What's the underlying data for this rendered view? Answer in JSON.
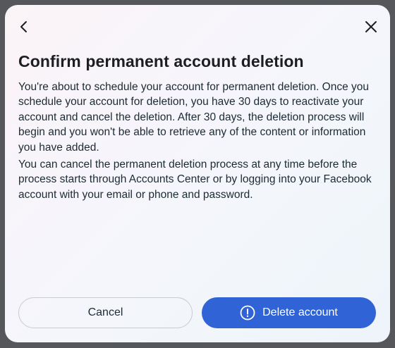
{
  "dialog": {
    "title": "Confirm permanent account deletion",
    "paragraphs": [
      "You're about to schedule your account for permanent deletion. Once you schedule your account for deletion, you have 30 days to reactivate your account and cancel the deletion. After 30 days, the deletion process will begin and you won't be able to retrieve any of the content or information you have added.",
      "You can cancel the permanent deletion process at any time before the process starts through Accounts Center or by logging into your Facebook account with your email or phone and password."
    ],
    "back_icon": "chevron-left-icon",
    "close_icon": "close-icon"
  },
  "buttons": {
    "cancel_label": "Cancel",
    "delete_label": "Delete account",
    "delete_icon": "alert-circle-icon",
    "delete_color": "#2f63d6"
  }
}
